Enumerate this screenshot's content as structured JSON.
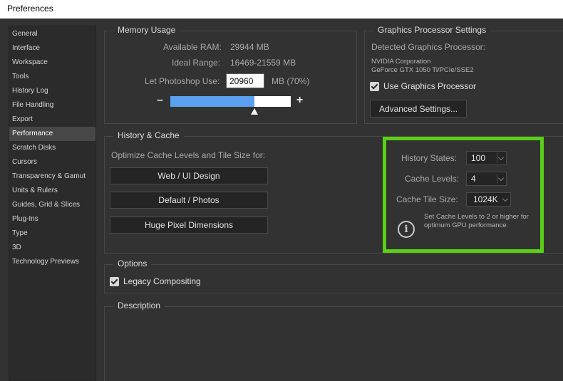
{
  "window": {
    "title": "Preferences"
  },
  "sidebar": {
    "items": [
      {
        "label": "General"
      },
      {
        "label": "Interface"
      },
      {
        "label": "Workspace"
      },
      {
        "label": "Tools"
      },
      {
        "label": "History Log"
      },
      {
        "label": "File Handling"
      },
      {
        "label": "Export"
      },
      {
        "label": "Performance",
        "selected": true
      },
      {
        "label": "Scratch Disks"
      },
      {
        "label": "Cursors"
      },
      {
        "label": "Transparency & Gamut"
      },
      {
        "label": "Units & Rulers"
      },
      {
        "label": "Guides, Grid & Slices"
      },
      {
        "label": "Plug-Ins"
      },
      {
        "label": "Type"
      },
      {
        "label": "3D"
      },
      {
        "label": "Technology Previews"
      }
    ]
  },
  "memory": {
    "legend": "Memory Usage",
    "available_label": "Available RAM:",
    "available_value": "29944 MB",
    "ideal_label": "Ideal Range:",
    "ideal_value": "16469-21559 MB",
    "let_label": "Let Photoshop Use:",
    "let_value": "20960",
    "let_unit": "MB (70%)",
    "slider_percent": 70,
    "minus": "–",
    "plus": "+"
  },
  "gpu": {
    "legend": "Graphics Processor Settings",
    "detected_label": "Detected Graphics Processor:",
    "vendor": "NVIDIA Corporation",
    "model": "GeForce GTX 1050 Ti/PCIe/SSE2",
    "use_label": "Use Graphics Processor",
    "use_checked": true,
    "advanced_button": "Advanced Settings..."
  },
  "history_cache": {
    "legend": "History & Cache",
    "optimize_label": "Optimize Cache Levels and Tile Size for:",
    "buttons": [
      "Web / UI Design",
      "Default / Photos",
      "Huge Pixel Dimensions"
    ],
    "history_states_label": "History States:",
    "history_states_value": "100",
    "cache_levels_label": "Cache Levels:",
    "cache_levels_value": "4",
    "tile_size_label": "Cache Tile Size:",
    "tile_size_value": "1024K",
    "note": "Set Cache Levels to 2 or higher for optimum GPU performance.",
    "highlight_color": "#59cf16"
  },
  "options": {
    "legend": "Options",
    "legacy_label": "Legacy Compositing",
    "legacy_checked": true
  },
  "description": {
    "legend": "Description"
  },
  "colors": {
    "background": "#323232",
    "slider_fill": "#5ba0ee",
    "accent_green": "#59cf16"
  }
}
